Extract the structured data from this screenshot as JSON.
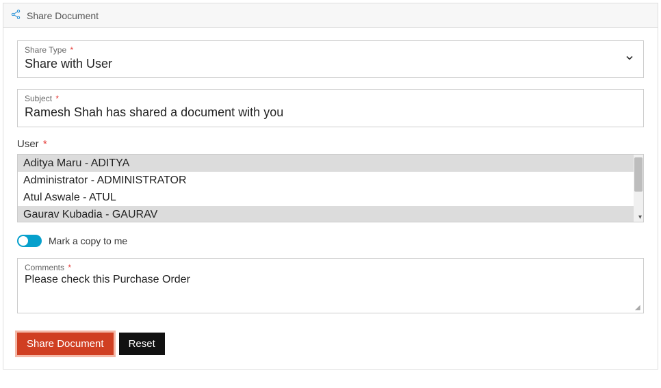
{
  "header": {
    "title": "Share Document"
  },
  "form": {
    "share_type": {
      "label": "Share Type",
      "value": "Share with User"
    },
    "subject": {
      "label": "Subject",
      "value": "Ramesh Shah has shared a document with you"
    },
    "user": {
      "label": "User",
      "options": [
        {
          "text": "Aditya Maru - ADITYA",
          "selected": true
        },
        {
          "text": "Administrator - ADMINISTRATOR",
          "selected": false
        },
        {
          "text": "Atul Aswale - ATUL",
          "selected": false
        },
        {
          "text": "Gaurav Kubadia - GAURAV",
          "selected": true
        }
      ]
    },
    "mark_copy": {
      "label": "Mark a copy to me",
      "value": true
    },
    "comments": {
      "label": "Comments",
      "value": "Please check this Purchase Order"
    }
  },
  "buttons": {
    "share": "Share Document",
    "reset": "Reset"
  },
  "required_marker": "*"
}
